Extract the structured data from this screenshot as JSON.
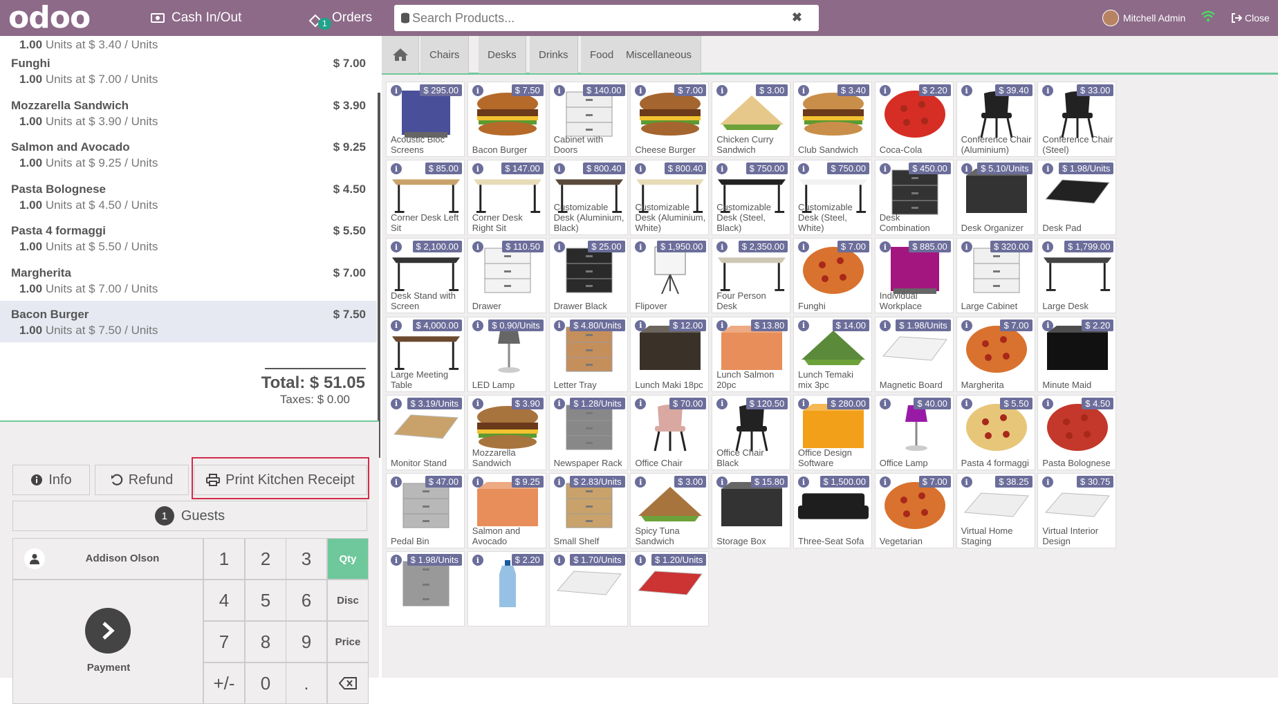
{
  "header": {
    "logo": "odoo",
    "cash_label": "Cash In/Out",
    "orders_label": "Orders",
    "orders_badge": "1",
    "search_placeholder": "Search Products...",
    "user_name": "Mitchell Admin",
    "close_label": "Close"
  },
  "order": {
    "partial_top": {
      "qty": "1.00",
      "rest": "Units at $ 3.40 / Units"
    },
    "lines": [
      {
        "name": "Funghi",
        "price": "$ 7.00",
        "qty": "1.00",
        "rest": "Units at $ 7.00 / Units"
      },
      {
        "name": "Mozzarella Sandwich",
        "price": "$ 3.90",
        "qty": "1.00",
        "rest": "Units at $ 3.90 / Units"
      },
      {
        "name": "Salmon and Avocado",
        "price": "$ 9.25",
        "qty": "1.00",
        "rest": "Units at $ 9.25 / Units"
      },
      {
        "name": "Pasta Bolognese",
        "price": "$ 4.50",
        "qty": "1.00",
        "rest": "Units at $ 4.50 / Units"
      },
      {
        "name": "Pasta 4 formaggi",
        "price": "$ 5.50",
        "qty": "1.00",
        "rest": "Units at $ 5.50 / Units"
      },
      {
        "name": "Margherita",
        "price": "$ 7.00",
        "qty": "1.00",
        "rest": "Units at $ 7.00 / Units"
      },
      {
        "name": "Bacon Burger",
        "price": "$ 7.50",
        "qty": "1.00",
        "rest": "Units at $ 7.50 / Units"
      }
    ],
    "total": "Total: $ 51.05",
    "taxes": "Taxes: $ 0.00"
  },
  "actions": {
    "info": "Info",
    "refund": "Refund",
    "print": "Print Kitchen Receipt",
    "guests_count": "1",
    "guests": "Guests",
    "customer": "Addison Olson",
    "payment": "Payment"
  },
  "numpad": {
    "keys": [
      "1",
      "2",
      "3",
      "4",
      "5",
      "6",
      "7",
      "8",
      "9",
      "+/-",
      "0",
      "."
    ],
    "modes": [
      "Qty",
      "Disc",
      "Price"
    ],
    "active_mode": "Qty"
  },
  "categories": [
    "Chairs",
    "Desks",
    "Drinks",
    "Food",
    "Miscellaneous"
  ],
  "colors": {
    "brand": "#8c6a88",
    "accent": "#6ec89b",
    "price_tag": "#6b6d9a",
    "highlight": "#d22a4b"
  },
  "products": [
    {
      "name": "Acoustic Bloc Screens",
      "price": "$ 295.00",
      "c": "#4a4f9a",
      "shape": "panel"
    },
    {
      "name": "Bacon Burger",
      "price": "$ 7.50",
      "c": "#b56a2a",
      "shape": "burger"
    },
    {
      "name": "Cabinet with Doors",
      "price": "$ 140.00",
      "c": "#eeeeee",
      "shape": "cabinet"
    },
    {
      "name": "Cheese Burger",
      "price": "$ 7.00",
      "c": "#a5652e",
      "shape": "burger"
    },
    {
      "name": "Chicken Curry Sandwich",
      "price": "$ 3.00",
      "c": "#e6c98a",
      "shape": "sandwich"
    },
    {
      "name": "Club Sandwich",
      "price": "$ 3.40",
      "c": "#c98f4a",
      "shape": "burger"
    },
    {
      "name": "Coca-Cola",
      "price": "$ 2.20",
      "c": "#d62d24",
      "shape": "round"
    },
    {
      "name": "Conference Chair (Aluminium)",
      "price": "$ 39.40",
      "c": "#222222",
      "shape": "chair"
    },
    {
      "name": "Conference Chair (Steel)",
      "price": "$ 33.00",
      "c": "#222222",
      "shape": "chair"
    },
    {
      "name": "Corner Desk Left Sit",
      "price": "$ 85.00",
      "c": "#c9a26b",
      "shape": "desk"
    },
    {
      "name": "Corner Desk Right Sit",
      "price": "$ 147.00",
      "c": "#e8dcb8",
      "shape": "desk"
    },
    {
      "name": "Customizable Desk (Aluminium, Black)",
      "price": "$ 800.40",
      "c": "#5a4a3c",
      "shape": "desk"
    },
    {
      "name": "Customizable Desk (Aluminium, White)",
      "price": "$ 800.40",
      "c": "#e8dcb8",
      "shape": "desk"
    },
    {
      "name": "Customizable Desk (Steel, Black)",
      "price": "$ 750.00",
      "c": "#222222",
      "shape": "desk"
    },
    {
      "name": "Customizable Desk (Steel, White)",
      "price": "$ 750.00",
      "c": "#f2f2f2",
      "shape": "desk"
    },
    {
      "name": "Desk Combination",
      "price": "$ 450.00",
      "c": "#333333",
      "shape": "cabinet"
    },
    {
      "name": "Desk Organizer",
      "price": "$ 5.10/Units",
      "c": "#333333",
      "shape": "box"
    },
    {
      "name": "Desk Pad",
      "price": "$ 1.98/Units",
      "c": "#222222",
      "shape": "pad"
    },
    {
      "name": "Desk Stand with Screen",
      "price": "$ 2,100.00",
      "c": "#333333",
      "shape": "desk"
    },
    {
      "name": "Drawer",
      "price": "$ 110.50",
      "c": "#f3f3f3",
      "shape": "cabinet"
    },
    {
      "name": "Drawer Black",
      "price": "$ 25.00",
      "c": "#2a2a2a",
      "shape": "cabinet"
    },
    {
      "name": "Flipover",
      "price": "$ 1,950.00",
      "c": "#f5f5f5",
      "shape": "easel"
    },
    {
      "name": "Four Person Desk",
      "price": "$ 2,350.00",
      "c": "#cfc7b6",
      "shape": "desk"
    },
    {
      "name": "Funghi",
      "price": "$ 7.00",
      "c": "#d9722e",
      "shape": "round"
    },
    {
      "name": "Individual Workplace",
      "price": "$ 885.00",
      "c": "#a3167f",
      "shape": "panel"
    },
    {
      "name": "Large Cabinet",
      "price": "$ 320.00",
      "c": "#f0f0f0",
      "shape": "cabinet"
    },
    {
      "name": "Large Desk",
      "price": "$ 1,799.00",
      "c": "#444444",
      "shape": "desk"
    },
    {
      "name": "Large Meeting Table",
      "price": "$ 4,000.00",
      "c": "#6b4a2e",
      "shape": "desk"
    },
    {
      "name": "LED Lamp",
      "price": "$ 0.90/Units",
      "c": "#666666",
      "shape": "lamp"
    },
    {
      "name": "Letter Tray",
      "price": "$ 4.80/Units",
      "c": "#c58f5c",
      "shape": "cabinet"
    },
    {
      "name": "Lunch Maki 18pc",
      "price": "$ 12.00",
      "c": "#3a3228",
      "shape": "box"
    },
    {
      "name": "Lunch Salmon 20pc",
      "price": "$ 13.80",
      "c": "#e88e5a",
      "shape": "box"
    },
    {
      "name": "Lunch Temaki mix 3pc",
      "price": "$ 14.00",
      "c": "#5a8a3a",
      "shape": "sandwich"
    },
    {
      "name": "Magnetic Board",
      "price": "$ 1.98/Units",
      "c": "#f2f2f2",
      "shape": "pad"
    },
    {
      "name": "Margherita",
      "price": "$ 7.00",
      "c": "#d9722e",
      "shape": "round"
    },
    {
      "name": "Minute Maid",
      "price": "$ 2.20",
      "c": "#111111",
      "shape": "box"
    },
    {
      "name": "Monitor Stand",
      "price": "$ 3.19/Units",
      "c": "#c9a26b",
      "shape": "pad"
    },
    {
      "name": "Mozzarella Sandwich",
      "price": "$ 3.90",
      "c": "#a8743e",
      "shape": "burger"
    },
    {
      "name": "Newspaper Rack",
      "price": "$ 1.28/Units",
      "c": "#888888",
      "shape": "cabinet"
    },
    {
      "name": "Office Chair",
      "price": "$ 70.00",
      "c": "#d9a8a0",
      "shape": "chair"
    },
    {
      "name": "Office Chair Black",
      "price": "$ 120.50",
      "c": "#222222",
      "shape": "chair"
    },
    {
      "name": "Office Design Software",
      "price": "$ 280.00",
      "c": "#f2a01a",
      "shape": "box"
    },
    {
      "name": "Office Lamp",
      "price": "$ 40.00",
      "c": "#9a1aa8",
      "shape": "lamp"
    },
    {
      "name": "Pasta 4 formaggi",
      "price": "$ 5.50",
      "c": "#e7c67a",
      "shape": "round"
    },
    {
      "name": "Pasta Bolognese",
      "price": "$ 4.50",
      "c": "#c3382a",
      "shape": "round"
    },
    {
      "name": "Pedal Bin",
      "price": "$ 47.00",
      "c": "#b8b8b8",
      "shape": "cabinet"
    },
    {
      "name": "Salmon and Avocado",
      "price": "$ 9.25",
      "c": "#e88e5a",
      "shape": "box"
    },
    {
      "name": "Small Shelf",
      "price": "$ 2.83/Units",
      "c": "#c9a26b",
      "shape": "cabinet"
    },
    {
      "name": "Spicy Tuna Sandwich",
      "price": "$ 3.00",
      "c": "#a8743e",
      "shape": "sandwich"
    },
    {
      "name": "Storage Box",
      "price": "$ 15.80",
      "c": "#333333",
      "shape": "box"
    },
    {
      "name": "Three-Seat Sofa",
      "price": "$ 1,500.00",
      "c": "#1e1e1e",
      "shape": "sofa"
    },
    {
      "name": "Vegetarian",
      "price": "$ 7.00",
      "c": "#d9722e",
      "shape": "round"
    },
    {
      "name": "Virtual Home Staging",
      "price": "$ 38.25",
      "c": "#eeeeee",
      "shape": "pad"
    },
    {
      "name": "Virtual Interior Design",
      "price": "$ 30.75",
      "c": "#eeeeee",
      "shape": "pad"
    },
    {
      "name": "",
      "price": "$ 1.98/Units",
      "c": "#999999",
      "shape": "cabinet"
    },
    {
      "name": "",
      "price": "$ 2.20",
      "c": "#6aa7d8",
      "shape": "bottle"
    },
    {
      "name": "",
      "price": "$ 1.70/Units",
      "c": "#eeeeee",
      "shape": "pad"
    },
    {
      "name": "",
      "price": "$ 1.20/Units",
      "c": "#cc3333",
      "shape": "pad"
    }
  ]
}
